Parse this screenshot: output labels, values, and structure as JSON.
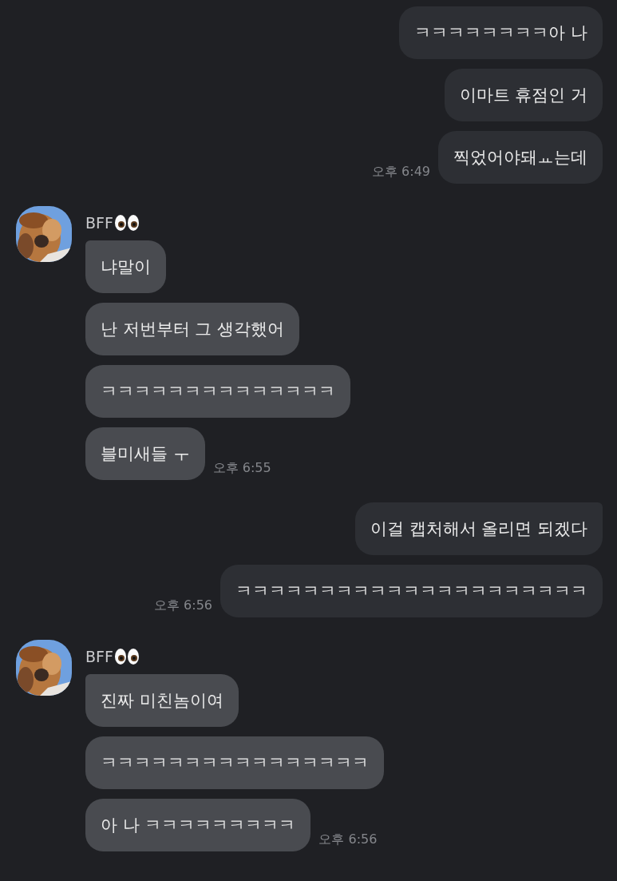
{
  "groups": [
    {
      "kind": "sent",
      "tail": false,
      "time": "오후 6:49",
      "messages": [
        "ㅋㅋㅋㅋㅋㅋㅋㅋ아 나",
        "이마트 휴점인 거",
        "찍었어야돼ㅛ는데"
      ]
    },
    {
      "kind": "received",
      "tail": true,
      "sender": "BFF",
      "avatar": {
        "kind": "picture"
      },
      "time": "오후 6:55",
      "messages": [
        "냐말이",
        "난 저번부터 그 생각했어",
        "ㅋㅋㅋㅋㅋㅋㅋㅋㅋㅋㅋㅋㅋㅋ",
        "블미새들 ㅜ"
      ]
    },
    {
      "kind": "sent",
      "tail": true,
      "time": "오후 6:56",
      "messages": [
        "이걸 캡처해서 올리면 되겠다",
        "ㅋㅋㅋㅋㅋㅋㅋㅋㅋㅋㅋㅋㅋㅋㅋㅋㅋㅋㅋㅋㅋ"
      ]
    },
    {
      "kind": "received",
      "tail": true,
      "sender": "BFF",
      "avatar": {
        "kind": "picture"
      },
      "time": "오후 6:56",
      "messages": [
        "진짜 미친놈이여",
        "ㅋㅋㅋㅋㅋㅋㅋㅋㅋㅋㅋㅋㅋㅋㅋㅋ",
        "아 나 ㅋㅋㅋㅋㅋㅋㅋㅋㅋ"
      ]
    }
  ]
}
